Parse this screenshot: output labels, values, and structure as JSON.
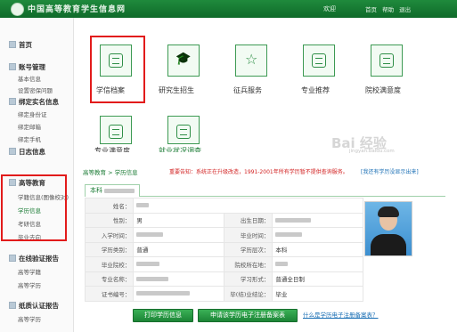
{
  "header": {
    "site_title": "中国高等教育学生信息网",
    "welcome": "欢迎",
    "links": [
      "首页",
      "帮助",
      "退出"
    ]
  },
  "sidebar": {
    "home": "首页",
    "account": "账号管理",
    "account_items": [
      "基本信息",
      "设置密保问题"
    ],
    "realname": "绑定实名信息",
    "realname_items": [
      "绑定身份证",
      "绑定邮箱",
      "绑定手机"
    ],
    "log": "日志信息",
    "higher_ed": "高等教育",
    "higher_ed_items": [
      "学籍信息(图像校对)",
      "学历信息",
      "考研信息",
      "毕业去向"
    ],
    "online_report": "在线验证报告",
    "online_report_items": [
      "高等学籍",
      "高等学历"
    ],
    "paper_report": "纸质认证报告",
    "paper_report_items": [
      "高等学历"
    ]
  },
  "services": [
    {
      "label": "学信档案",
      "icon": "document-icon"
    },
    {
      "label": "研究生招生",
      "icon": "graduation-cap-icon"
    },
    {
      "label": "征兵服务",
      "icon": "star-icon"
    },
    {
      "label": "专业推荐",
      "icon": "chat-icon"
    },
    {
      "label": "院校满意度",
      "icon": "school-icon"
    },
    {
      "label": "专业满意度",
      "icon": "heart-book-icon"
    },
    {
      "label": "就业状况调查",
      "icon": "survey-icon"
    }
  ],
  "breadcrumb": {
    "path": "高等教育 > 学历信息",
    "notice": "重要告知：系统正在升级改造，1991-2001年所有学历暂不提供查询服务。",
    "right_link": "[我还有学历没显示出来]"
  },
  "tab": {
    "label": "本科"
  },
  "record": {
    "name_label": "姓名：",
    "gender_label": "性别：",
    "gender_value": "男",
    "birth_label": "出生日期：",
    "enroll_label": "入学时间：",
    "grad_label": "毕业时间：",
    "type_label": "学历类别：",
    "type_value": "普通",
    "level_label": "学历层次：",
    "level_value": "本科",
    "school_label": "毕业院校：",
    "location_label": "院校所在地：",
    "major_label": "专业名称：",
    "form_label": "学习形式：",
    "form_value": "普通全日制",
    "cert_label": "证书编号：",
    "result_label": "毕(结)业结论：",
    "result_value": "毕业"
  },
  "actions": {
    "print": "打印学历信息",
    "apply": "申请该学历电子注册备案表",
    "faq": "什么是学历电子注册备案表？"
  },
  "watermark": {
    "text": "Bai 经验",
    "sub": "jingyan.baidu.com"
  },
  "colors": {
    "brand_green": "#1a7b34",
    "highlight_red": "#e21b1b",
    "notice_red": "#d22222"
  }
}
